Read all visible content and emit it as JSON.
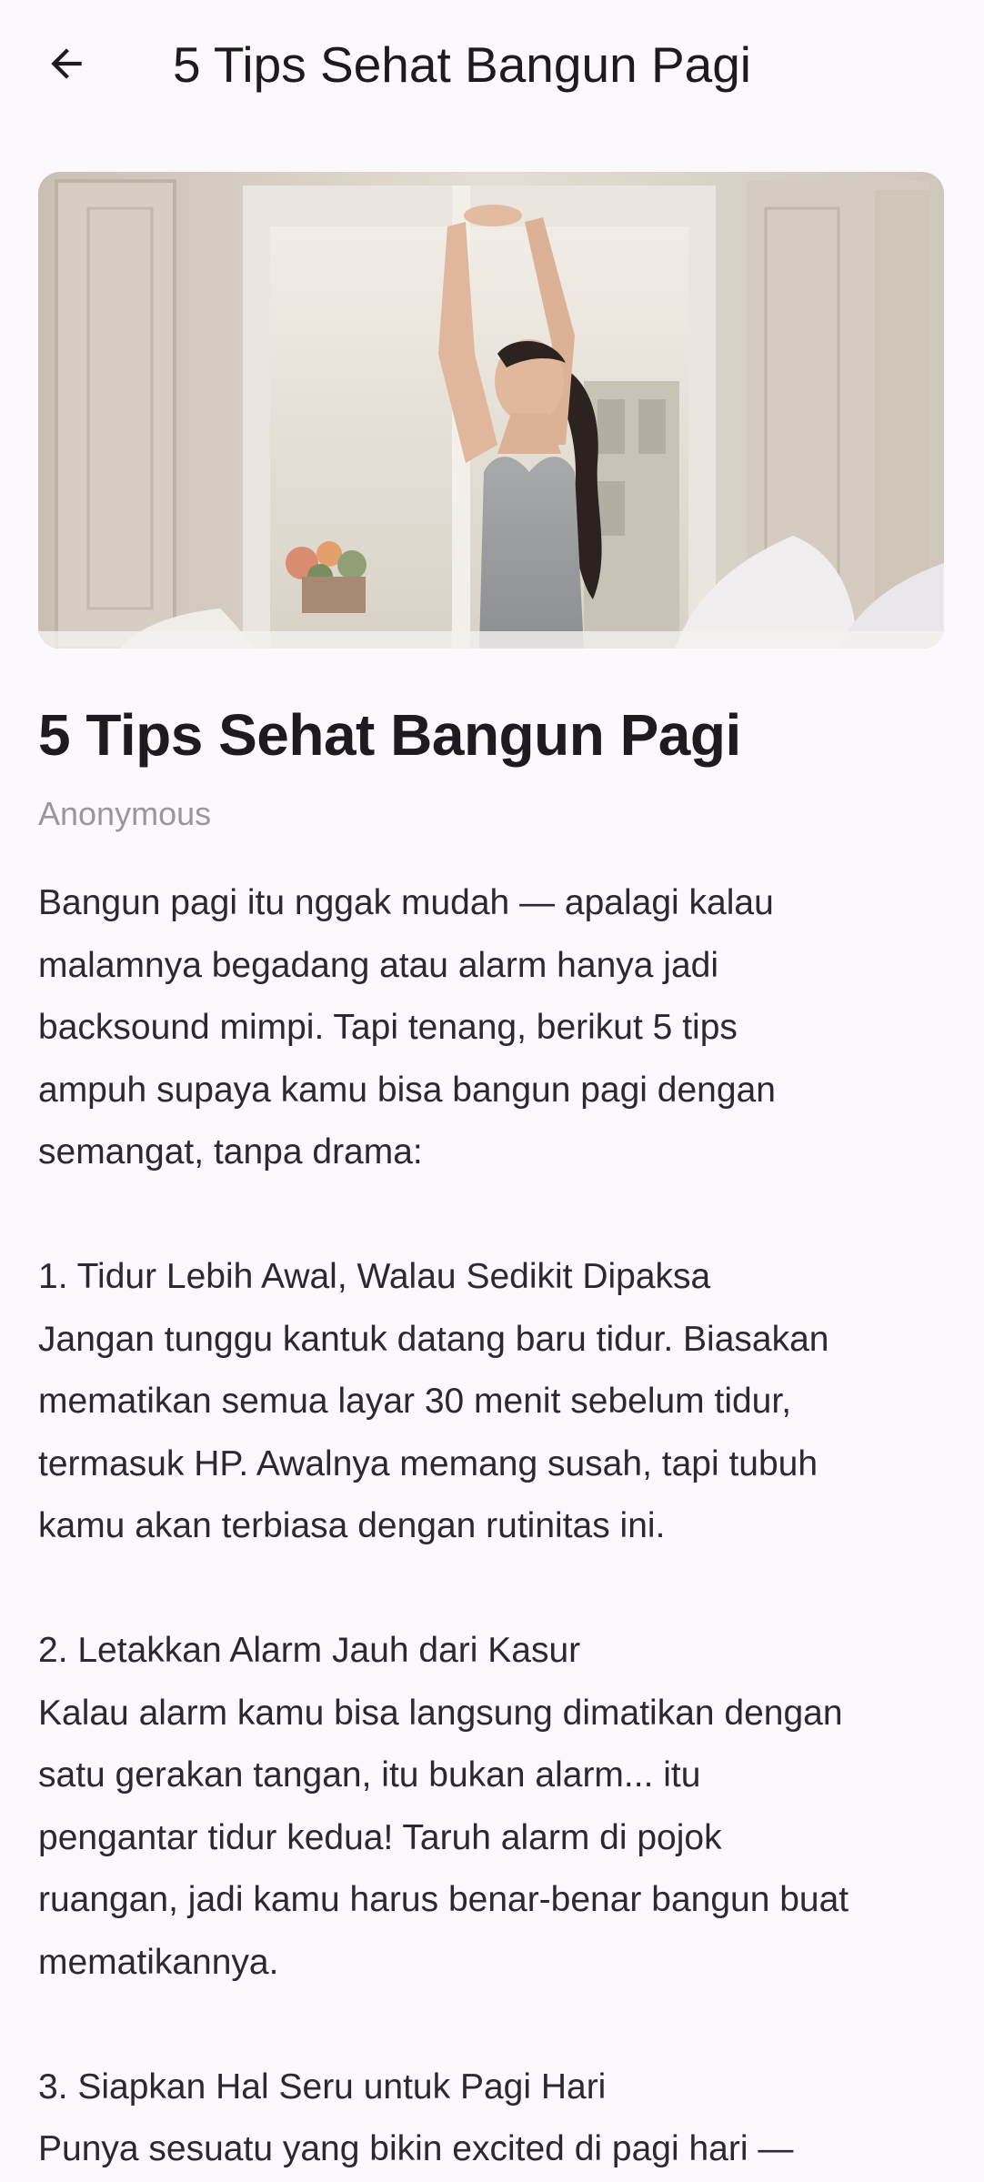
{
  "app_bar": {
    "title": "5 Tips Sehat Bangun Pagi",
    "back_icon": "arrow-left-icon"
  },
  "article": {
    "title": "5 Tips Sehat Bangun Pagi",
    "author": "Anonymous",
    "body": "Bangun pagi itu nggak mudah — apalagi kalau\nmalamnya begadang atau alarm hanya jadi\nbacksound mimpi. Tapi tenang, berikut 5 tips\nampuh supaya kamu bisa bangun pagi dengan\nsemangat, tanpa drama:\n\n1. Tidur Lebih Awal, Walau Sedikit Dipaksa\nJangan tunggu kantuk datang baru tidur. Biasakan\nmematikan semua layar 30 menit sebelum tidur,\ntermasuk HP. Awalnya memang susah, tapi tubuh\nkamu akan terbiasa dengan rutinitas ini.\n\n2. Letakkan Alarm Jauh dari Kasur\nKalau alarm kamu bisa langsung dimatikan dengan\nsatu gerakan tangan, itu bukan alarm... itu\npengantar tidur kedua! Taruh alarm di pojok\nruangan, jadi kamu harus benar-benar bangun buat\nmematikannya.\n\n3. Siapkan Hal Seru untuk Pagi Hari\nPunya sesuatu yang bikin excited di pagi hari —"
  },
  "colors": {
    "background": "#fdf7fe",
    "text": "#1d1b20",
    "muted": "#9a979c"
  }
}
